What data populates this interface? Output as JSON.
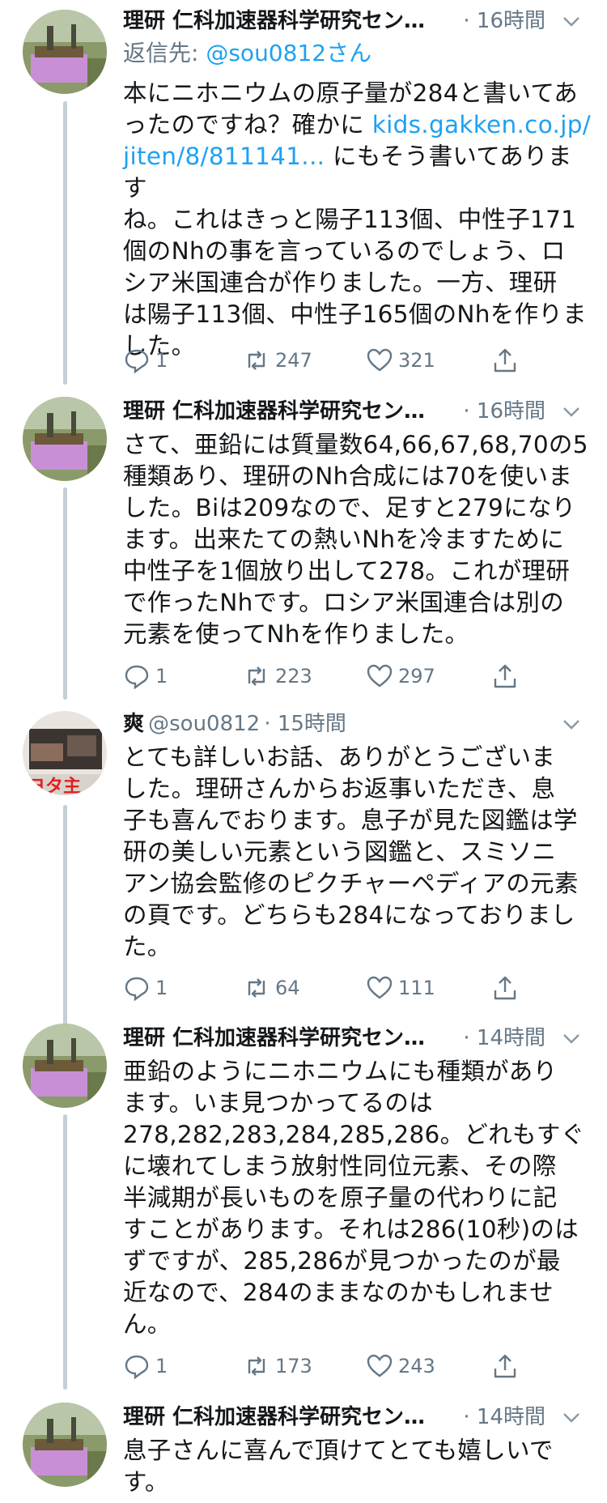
{
  "tweets": [
    {
      "name": "理研 仁科加速器科学研究セン…",
      "time": "· 16時間",
      "reply_prefix": "返信先: ",
      "reply_handle": "@sou0812さん",
      "lines": [
        "本にニホニウムの原子量が284と書いてあ",
        "ったのですね？確かに ",
        "jiten/8/811141...",
        "ね。これはきっと陽子113個、中性子171",
        "個のNhの事を言っているのでしょう、ロ",
        "シア米国連合が作りました。一方、理研",
        "は陽子113個、中性子165個のNhを作りま",
        "した。"
      ],
      "link1": "kids.gakken.co.jp/",
      "line3_suffix": " にもそう書いてありますb",
      "replies": "1",
      "retweets": "247",
      "likes": "321"
    },
    {
      "name": "理研 仁科加速器科学研究セン…",
      "time": "· 16時間",
      "lines": [
        "さて、亜鉛には質量数64,66,67,68,70の5",
        "種類あり、理研のNh合成には70を使いま",
        "した。Biは209なので、足すと279になり",
        "ます。出来たての熱いNhを冷ますために",
        "中性子を1個放り出して278。これが理研",
        "で作ったNhです。ロシア米国連合は別の",
        "元素を使ってNhを作りました。"
      ],
      "replies": "1",
      "retweets": "223",
      "likes": "297"
    },
    {
      "name": "爽",
      "handle": "@sou0812",
      "time": "· 15時間",
      "lines": [
        "とても詳しいお話、ありがとうございま",
        "した。理研さんからお返事いただき、息",
        "子も喜んでおります。息子が見た図鑑は学",
        "研の美しい元素という図鑑と、スミソニ",
        "アン協会監修のピクチャーペディアの元素",
        "の頁です。どちらも284になっておりまし",
        "た。"
      ],
      "replies": "1",
      "retweets": "64",
      "likes": "111"
    },
    {
      "name": "理研 仁科加速器科学研究セン…",
      "time": "· 14時間",
      "lines": [
        "亜鉛のようにニホニウムにも種類があり",
        "ます。いま見つかってるのは",
        "278,282,283,284,285,286。どれもすぐ",
        "に壊れてしまう放射性同位元素、その際",
        "半減期が長いものを原子量の代わりに記",
        "すことがあります。それは286(10秒)のは",
        "ずですが、285,286が見つかったのが最",
        "近なので、284のままなのかもしれませ",
        "ん。"
      ],
      "replies": "1",
      "retweets": "173",
      "likes": "243"
    },
    {
      "name": "理研 仁科加速器科学研究セン…",
      "time": "· 14時間",
      "lines": [
        "息子さんに喜んで頂けてとても嬉しいで",
        "す。"
      ]
    }
  ],
  "colors": {
    "link": "#1da1f2",
    "muted": "#657786",
    "text": "#14171a",
    "thread": "#c4cfd6"
  }
}
